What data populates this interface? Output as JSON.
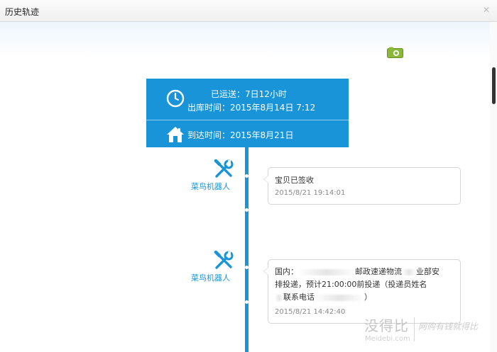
{
  "window": {
    "title": "历史轨迹",
    "close_glyph": "✕"
  },
  "icons": {
    "camera": "camera-icon",
    "clock": "clock-icon",
    "house": "house-icon",
    "tools": "tools-icon"
  },
  "colors": {
    "accent": "#1a94d9",
    "camera": "#8bb83a"
  },
  "summary": {
    "shipped_duration": "已运送：7日12小时",
    "outbound_time": "出库时间：2015年8月14日 7:12",
    "arrival_time": "到达时间：2015年8月21日"
  },
  "timeline": [
    {
      "actor": "菜鸟机器人",
      "message": "宝贝已签收",
      "time": "2015/8/21 19:14:01"
    },
    {
      "actor": "菜鸟机器人",
      "message_parts": [
        "国内：",
        "邮政速递物流",
        "业部安"
      ],
      "message_line2": "排投递，预计21:00:00前投递（投递员姓名",
      "message_line3": "联系电话",
      "message_line3_tail": "）",
      "time": "2015/8/21 14:42:40"
    }
  ],
  "watermark": {
    "brand": "没得比",
    "domain": "Meidebi.com",
    "slogan": "网购有钱就得比"
  }
}
